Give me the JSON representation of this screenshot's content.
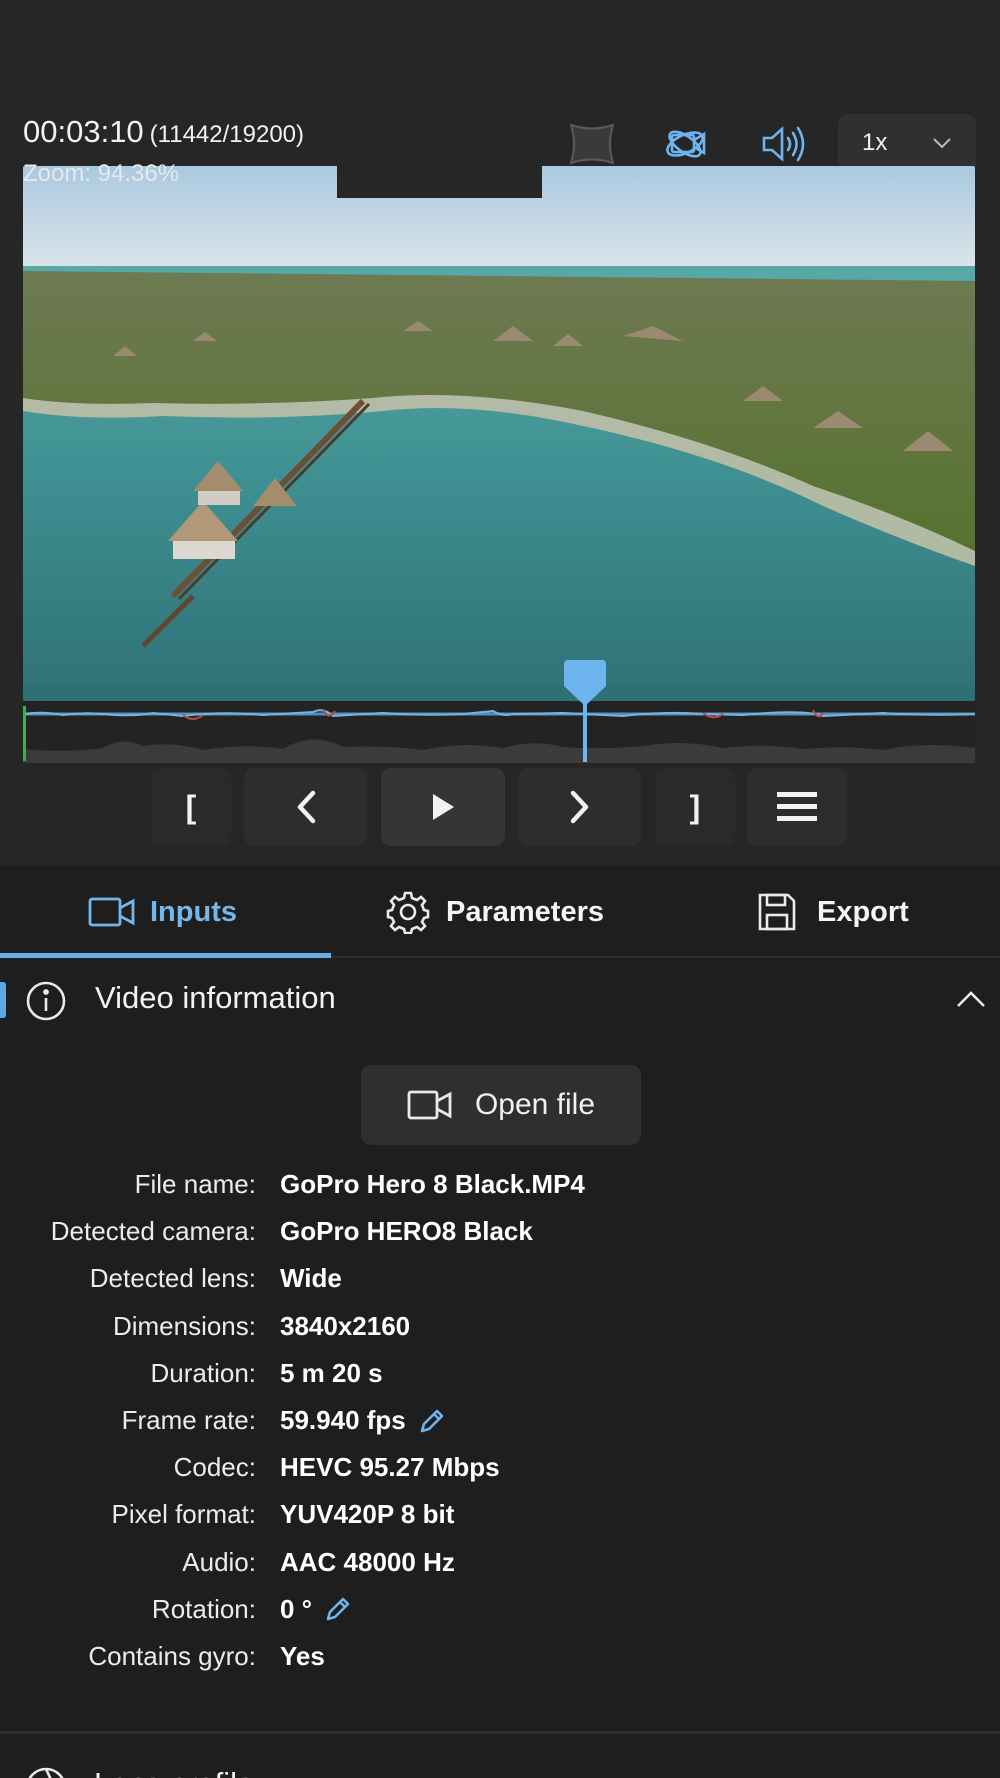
{
  "player": {
    "timecode": "00:03:10",
    "frames": "(11442/19200)",
    "zoom": "Zoom: 94.36%",
    "speed": "1x",
    "playhead_fraction": 0.59
  },
  "controls": {
    "trim_start": "[",
    "trim_end": "]"
  },
  "tabs": [
    {
      "label": "Inputs"
    },
    {
      "label": "Parameters"
    },
    {
      "label": "Export"
    }
  ],
  "section": {
    "title": "Video information",
    "open_file": "Open file"
  },
  "info": {
    "file_name": {
      "label": "File name:",
      "value": "GoPro Hero 8 Black.MP4"
    },
    "camera": {
      "label": "Detected camera:",
      "value": "GoPro HERO8 Black"
    },
    "lens": {
      "label": "Detected lens:",
      "value": "Wide"
    },
    "dimensions": {
      "label": "Dimensions:",
      "value": "3840x2160"
    },
    "duration": {
      "label": "Duration:",
      "value": "5 m 20 s"
    },
    "frame_rate": {
      "label": "Frame rate:",
      "value": "59.940 fps"
    },
    "codec": {
      "label": "Codec:",
      "value": "HEVC 95.27 Mbps"
    },
    "pixel_format": {
      "label": "Pixel format:",
      "value": "YUV420P 8 bit"
    },
    "audio": {
      "label": "Audio:",
      "value": "AAC 48000 Hz"
    },
    "rotation": {
      "label": "Rotation:",
      "value": "0 °"
    },
    "gyro": {
      "label": "Contains gyro:",
      "value": "Yes"
    }
  },
  "next_section": {
    "title": "Lens profile"
  },
  "colors": {
    "accent": "#6aaee8",
    "background": "#1e1e1e",
    "panel": "#262626"
  }
}
